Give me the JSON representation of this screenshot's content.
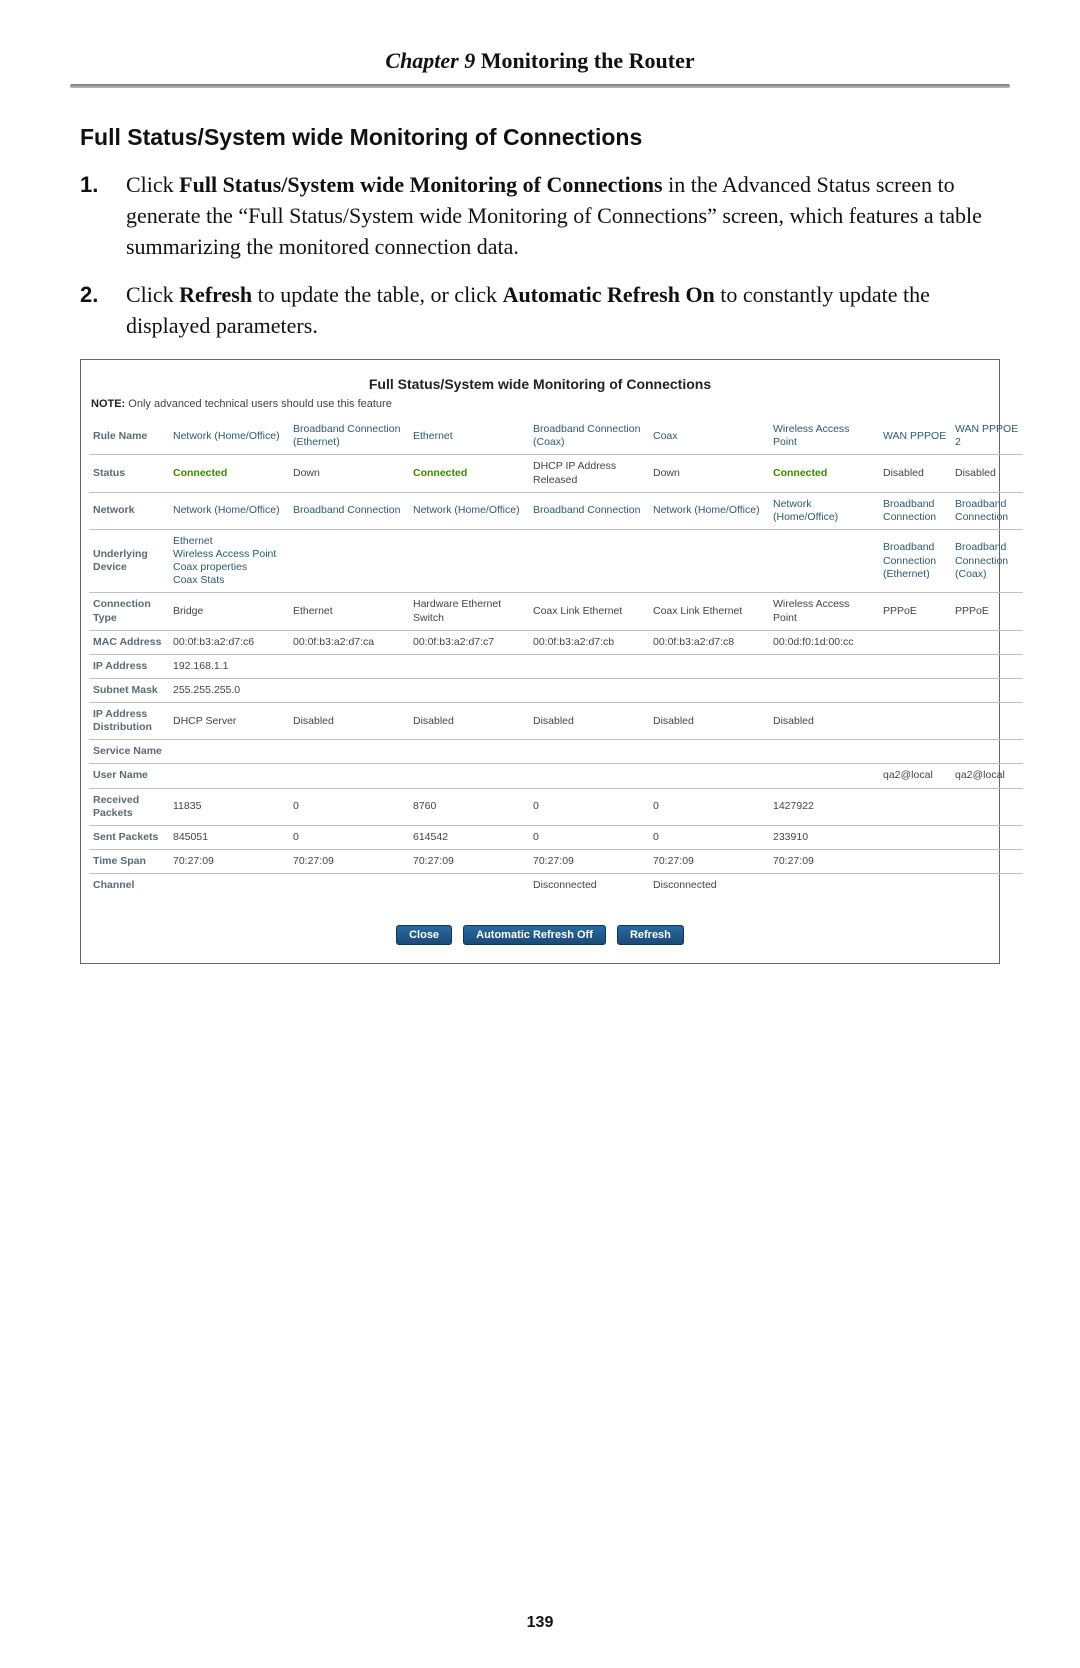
{
  "chapter": {
    "label": "Chapter 9",
    "title": "Monitoring the Router"
  },
  "section_title": "Full Status/System wide Monitoring of Connections",
  "steps": [
    {
      "num": "1.",
      "pre": "Click ",
      "bold1": "Full Status/System wide Monitoring of Connections",
      "mid": " in the Advanced Status screen to generate the “Full Status/System wide Monitoring of Connections” screen, which features a table summarizing the monitored connection data.",
      "bold2": "",
      "mid2": "",
      "bold3": "",
      "tail": ""
    },
    {
      "num": "2.",
      "pre": "Click ",
      "bold1": "Refresh",
      "mid": " to update the table, or click ",
      "bold2": "Automatic Refresh On",
      "mid2": " to constantly update the displayed parameters.",
      "bold3": "",
      "tail": ""
    }
  ],
  "panel": {
    "title": "Full Status/System wide Monitoring of Connections",
    "note_label": "NOTE:",
    "note_text": " Only advanced technical users should use this feature",
    "row_labels": [
      "Rule Name",
      "Status",
      "Network",
      "Underlying Device",
      "Connection Type",
      "MAC Address",
      "IP Address",
      "Subnet Mask",
      "IP Address Distribution",
      "Service Name",
      "User Name",
      "Received Packets",
      "Sent Packets",
      "Time Span",
      "Channel"
    ],
    "columns": [
      {
        "rule_name": {
          "text": "Network (Home/Office)",
          "cls": "linkish"
        },
        "status": {
          "text": "Connected",
          "cls": "green"
        },
        "network": {
          "text": "Network (Home/Office)",
          "cls": "linkish"
        },
        "underlying": {
          "text": "Ethernet\nWireless Access Point\nCoax properties\nCoax Stats",
          "cls": "linkish"
        },
        "conn_type": {
          "text": "Bridge"
        },
        "mac": {
          "text": "00:0f:b3:a2:d7:c6"
        },
        "ip": {
          "text": "192.168.1.1"
        },
        "subnet": {
          "text": "255.255.255.0"
        },
        "ip_dist": {
          "text": "DHCP Server"
        },
        "service": {
          "text": ""
        },
        "user": {
          "text": ""
        },
        "recv": {
          "text": "11835"
        },
        "sent": {
          "text": "845051"
        },
        "timespan": {
          "text": "70:27:09"
        },
        "channel": {
          "text": ""
        }
      },
      {
        "rule_name": {
          "text": "Broadband Connection (Ethernet)",
          "cls": "linkish"
        },
        "status": {
          "text": "Down"
        },
        "network": {
          "text": "Broadband Connection",
          "cls": "linkish"
        },
        "underlying": {
          "text": ""
        },
        "conn_type": {
          "text": "Ethernet"
        },
        "mac": {
          "text": "00:0f:b3:a2:d7:ca"
        },
        "ip": {
          "text": ""
        },
        "subnet": {
          "text": ""
        },
        "ip_dist": {
          "text": "Disabled"
        },
        "service": {
          "text": ""
        },
        "user": {
          "text": ""
        },
        "recv": {
          "text": "0"
        },
        "sent": {
          "text": "0"
        },
        "timespan": {
          "text": "70:27:09"
        },
        "channel": {
          "text": ""
        }
      },
      {
        "rule_name": {
          "text": "Ethernet",
          "cls": "linkish"
        },
        "status": {
          "text": "Connected",
          "cls": "green"
        },
        "network": {
          "text": "Network (Home/Office)",
          "cls": "linkish"
        },
        "underlying": {
          "text": ""
        },
        "conn_type": {
          "text": "Hardware Ethernet Switch"
        },
        "mac": {
          "text": "00:0f:b3:a2:d7:c7"
        },
        "ip": {
          "text": ""
        },
        "subnet": {
          "text": ""
        },
        "ip_dist": {
          "text": "Disabled"
        },
        "service": {
          "text": ""
        },
        "user": {
          "text": ""
        },
        "recv": {
          "text": "8760"
        },
        "sent": {
          "text": "614542"
        },
        "timespan": {
          "text": "70:27:09"
        },
        "channel": {
          "text": ""
        }
      },
      {
        "rule_name": {
          "text": "Broadband Connection (Coax)",
          "cls": "linkish"
        },
        "status": {
          "text": "DHCP IP Address Released"
        },
        "network": {
          "text": "Broadband Connection",
          "cls": "linkish"
        },
        "underlying": {
          "text": ""
        },
        "conn_type": {
          "text": "Coax Link Ethernet"
        },
        "mac": {
          "text": "00:0f:b3:a2:d7:cb"
        },
        "ip": {
          "text": ""
        },
        "subnet": {
          "text": ""
        },
        "ip_dist": {
          "text": "Disabled"
        },
        "service": {
          "text": ""
        },
        "user": {
          "text": ""
        },
        "recv": {
          "text": "0"
        },
        "sent": {
          "text": "0"
        },
        "timespan": {
          "text": "70:27:09"
        },
        "channel": {
          "text": "Disconnected"
        }
      },
      {
        "rule_name": {
          "text": "Coax",
          "cls": "linkish"
        },
        "status": {
          "text": "Down"
        },
        "network": {
          "text": "Network (Home/Office)",
          "cls": "linkish"
        },
        "underlying": {
          "text": ""
        },
        "conn_type": {
          "text": "Coax Link Ethernet"
        },
        "mac": {
          "text": "00:0f:b3:a2:d7:c8"
        },
        "ip": {
          "text": ""
        },
        "subnet": {
          "text": ""
        },
        "ip_dist": {
          "text": "Disabled"
        },
        "service": {
          "text": ""
        },
        "user": {
          "text": ""
        },
        "recv": {
          "text": "0"
        },
        "sent": {
          "text": "0"
        },
        "timespan": {
          "text": "70:27:09"
        },
        "channel": {
          "text": "Disconnected"
        }
      },
      {
        "rule_name": {
          "text": "Wireless Access Point",
          "cls": "linkish"
        },
        "status": {
          "text": "Connected",
          "cls": "green"
        },
        "network": {
          "text": "Network (Home/Office)",
          "cls": "linkish"
        },
        "underlying": {
          "text": ""
        },
        "conn_type": {
          "text": "Wireless Access Point"
        },
        "mac": {
          "text": "00:0d:f0:1d:00:cc"
        },
        "ip": {
          "text": ""
        },
        "subnet": {
          "text": ""
        },
        "ip_dist": {
          "text": "Disabled"
        },
        "service": {
          "text": ""
        },
        "user": {
          "text": ""
        },
        "recv": {
          "text": "1427922"
        },
        "sent": {
          "text": "233910"
        },
        "timespan": {
          "text": "70:27:09"
        },
        "channel": {
          "text": ""
        }
      },
      {
        "rule_name": {
          "text": "WAN PPPOE",
          "cls": "linkish"
        },
        "status": {
          "text": "Disabled"
        },
        "network": {
          "text": "Broadband Connection",
          "cls": "linkish"
        },
        "underlying": {
          "text": "Broadband Connection (Ethernet)",
          "cls": "linkish"
        },
        "conn_type": {
          "text": "PPPoE"
        },
        "mac": {
          "text": ""
        },
        "ip": {
          "text": ""
        },
        "subnet": {
          "text": ""
        },
        "ip_dist": {
          "text": ""
        },
        "service": {
          "text": ""
        },
        "user": {
          "text": "qa2@local"
        },
        "recv": {
          "text": ""
        },
        "sent": {
          "text": ""
        },
        "timespan": {
          "text": ""
        },
        "channel": {
          "text": ""
        }
      },
      {
        "rule_name": {
          "text": "WAN PPPOE 2",
          "cls": "linkish"
        },
        "status": {
          "text": "Disabled"
        },
        "network": {
          "text": "Broadband Connection",
          "cls": "linkish"
        },
        "underlying": {
          "text": "Broadband Connection (Coax)",
          "cls": "linkish"
        },
        "conn_type": {
          "text": "PPPoE"
        },
        "mac": {
          "text": ""
        },
        "ip": {
          "text": ""
        },
        "subnet": {
          "text": ""
        },
        "ip_dist": {
          "text": ""
        },
        "service": {
          "text": ""
        },
        "user": {
          "text": "qa2@local"
        },
        "recv": {
          "text": ""
        },
        "sent": {
          "text": ""
        },
        "timespan": {
          "text": ""
        },
        "channel": {
          "text": ""
        }
      }
    ],
    "buttons": {
      "close": "Close",
      "auto": "Automatic Refresh Off",
      "refresh": "Refresh"
    }
  },
  "page_number": "139"
}
